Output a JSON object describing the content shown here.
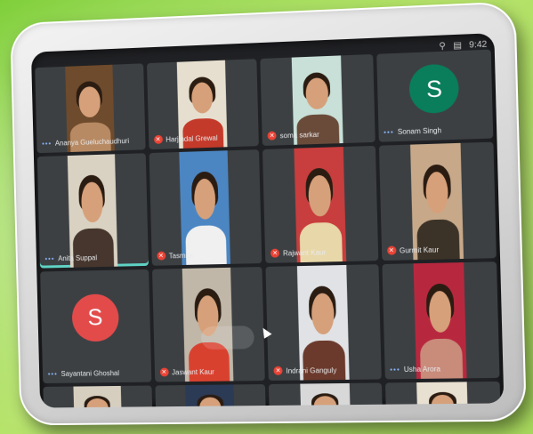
{
  "meeting": {
    "topbar": [
      "⚲",
      "▤",
      "9:42"
    ],
    "participants": [
      {
        "name": "Ananya Gueluchaudhuri",
        "type": "video",
        "bg": "#6e4b2c",
        "shirt": "#b78a63",
        "muted": false,
        "dots": true
      },
      {
        "name": "Harjindal Grewal",
        "type": "video",
        "bg": "#e6dfcf",
        "shirt": "#c43a2a",
        "muted": true
      },
      {
        "name": "soma sarkar",
        "type": "video",
        "bg": "#c8e0d8",
        "shirt": "#6a4b3a",
        "muted": true
      },
      {
        "name": "Sonam Singh",
        "type": "avatar",
        "initial": "S",
        "color": "#0a7d5a",
        "muted": false,
        "dots": true
      },
      {
        "name": "Anita Suppal",
        "type": "video",
        "bg": "#d9d2c3",
        "shirt": "#46362d",
        "muted": false,
        "dots": true,
        "active": true
      },
      {
        "name": "Tasmita",
        "type": "video",
        "bg": "#4b86c3",
        "shirt": "#f0f0f0",
        "muted": true
      },
      {
        "name": "Rajwant Kaur",
        "type": "video",
        "bg": "#c83d3d",
        "shirt": "#e8d7a8",
        "muted": true
      },
      {
        "name": "Gurmit Kaur",
        "type": "video",
        "bg": "#c7a98a",
        "shirt": "#3c3328",
        "muted": true
      },
      {
        "name": "Sayantani Ghoshal",
        "type": "avatar",
        "initial": "S",
        "color": "#e34b4b",
        "muted": false,
        "dots": true
      },
      {
        "name": "Jaswant Kaur",
        "type": "video",
        "bg": "#c0b7a8",
        "shirt": "#d9412f",
        "muted": true
      },
      {
        "name": "Indrani Ganguly",
        "type": "video",
        "bg": "#e0e2e5",
        "shirt": "#6b3a2c",
        "muted": true
      },
      {
        "name": "Usha Arora",
        "type": "video",
        "bg": "#b7283f",
        "shirt": "#c98b7a",
        "muted": false,
        "dots": true
      },
      {
        "name": "",
        "type": "video",
        "bg": "#d6cfc0",
        "shirt": "#2c2c2c",
        "muted": false
      },
      {
        "name": "",
        "type": "video",
        "bg": "#2b3a55",
        "shirt": "#4a3a30",
        "muted": false
      },
      {
        "name": "",
        "type": "video",
        "bg": "#d8d8d8",
        "shirt": "#3a3a3a",
        "muted": false
      },
      {
        "name": "",
        "type": "video",
        "bg": "#e8e0d0",
        "shirt": "#6c4a38",
        "muted": false
      }
    ]
  }
}
